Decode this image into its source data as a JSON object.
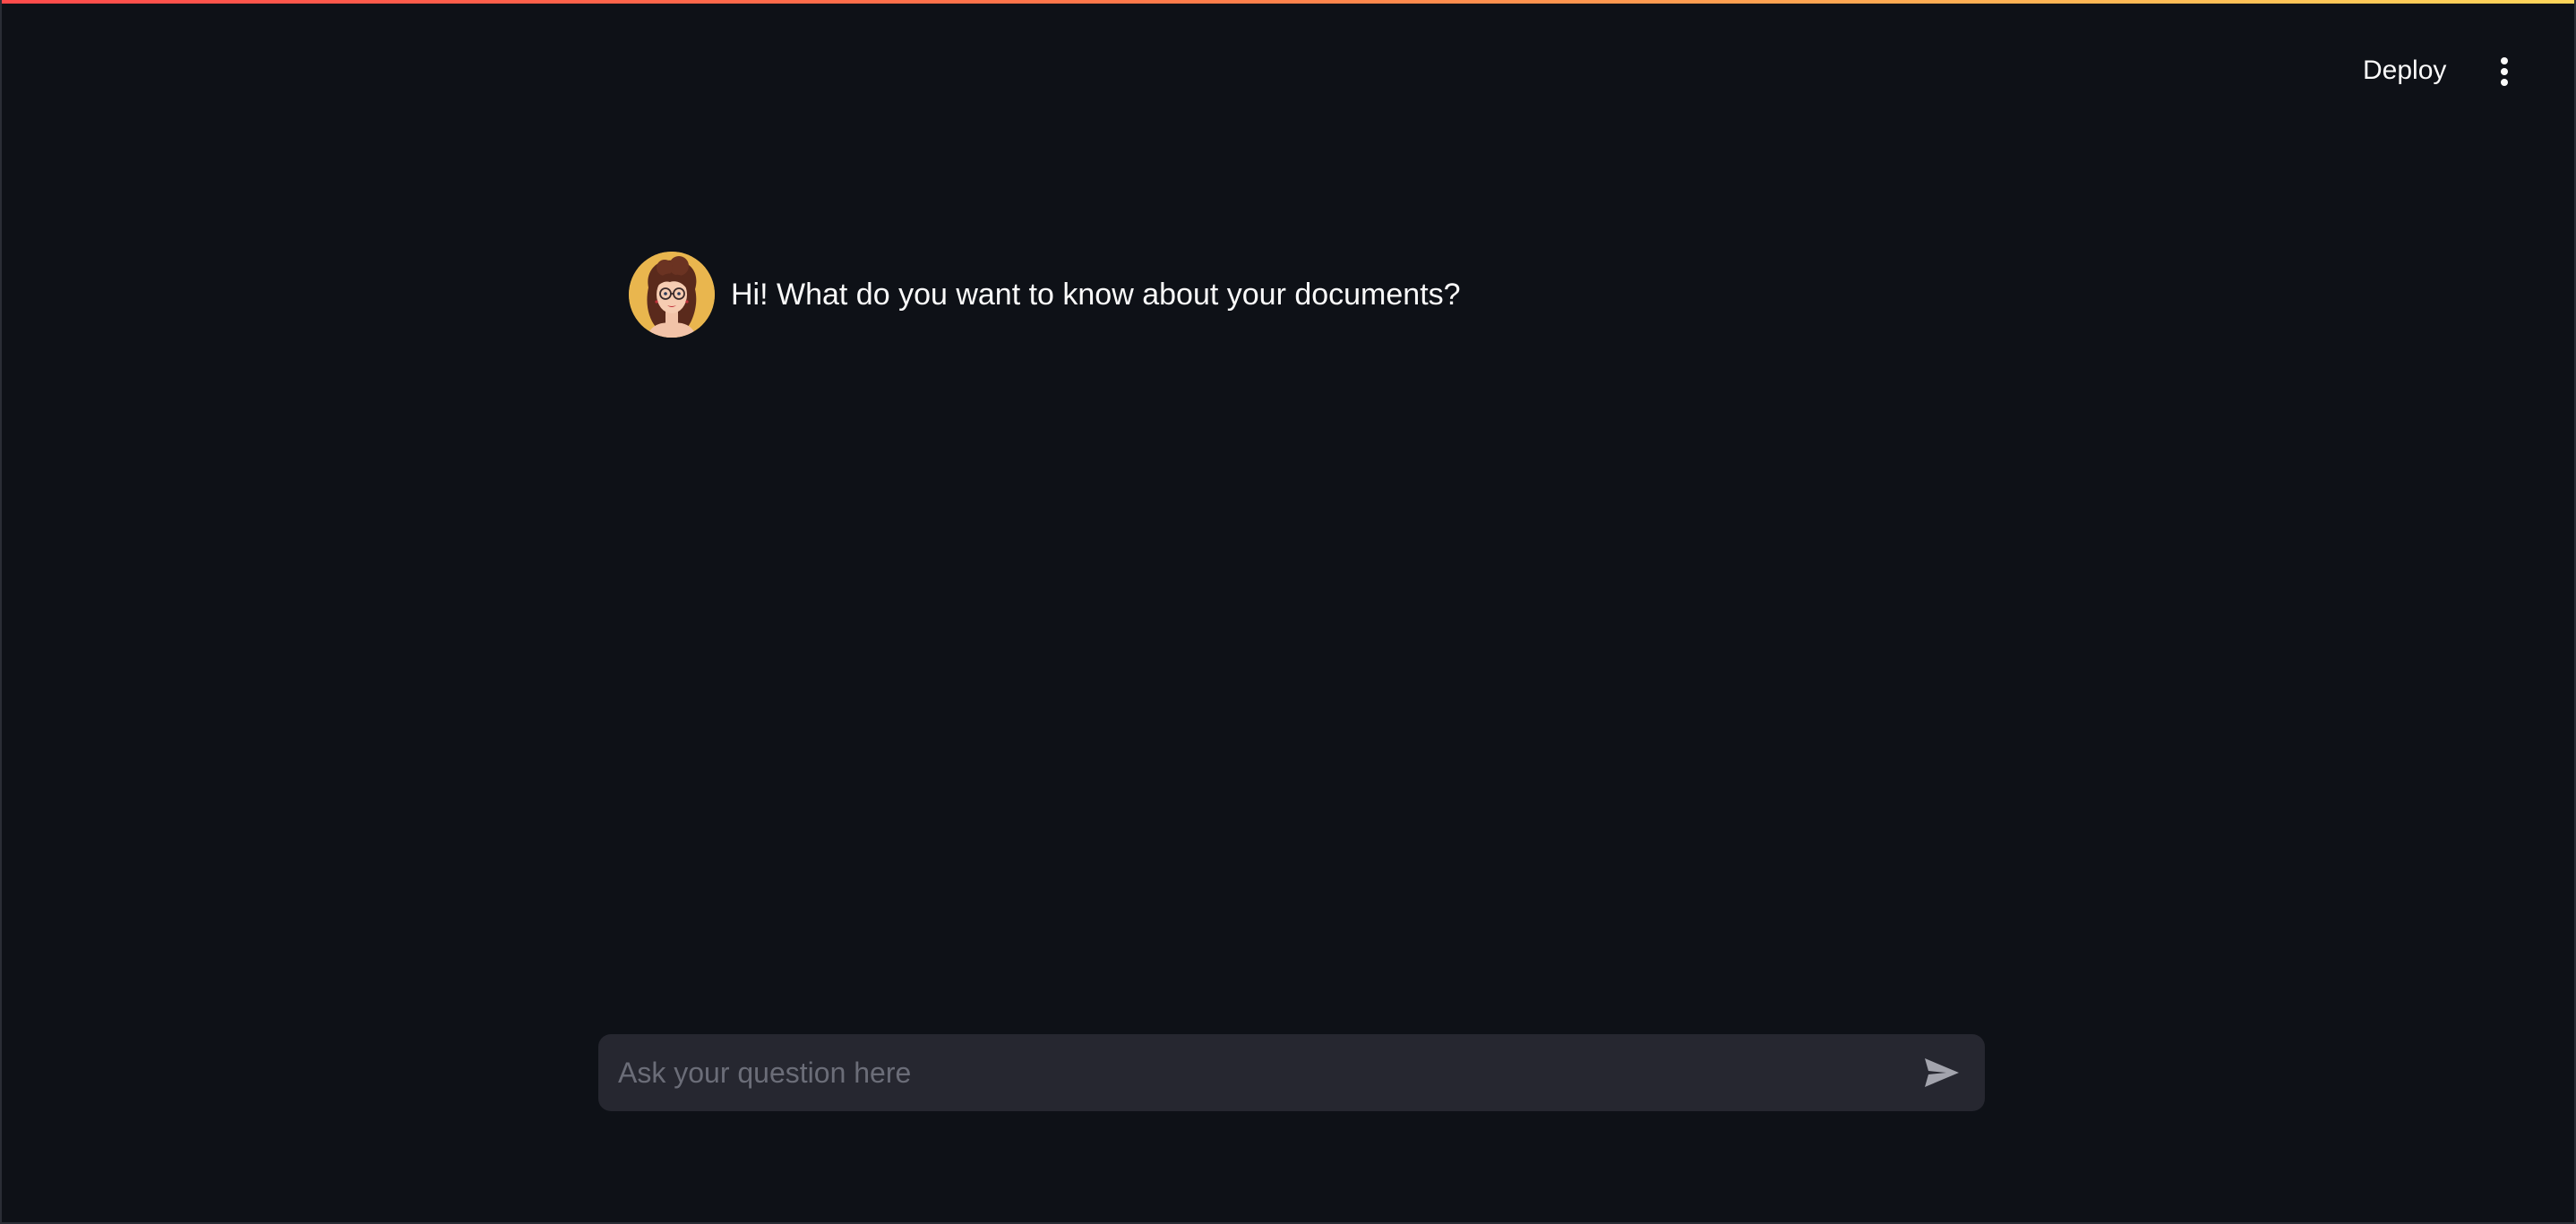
{
  "colors": {
    "background": "#0e1117",
    "input_background": "#262730",
    "text": "#fafafa",
    "placeholder": "#6b6d78",
    "avatar_background": "#e9b64e"
  },
  "header": {
    "deploy_label": "Deploy",
    "menu_icon": "vertical-ellipsis-icon"
  },
  "chat": {
    "messages": [
      {
        "role": "assistant",
        "avatar_icon": "woman-with-glasses-avatar",
        "text": "Hi! What do you want to know about your documents?"
      }
    ],
    "input": {
      "placeholder": "Ask your question here",
      "value": "",
      "send_icon": "paper-plane-send-icon"
    }
  }
}
